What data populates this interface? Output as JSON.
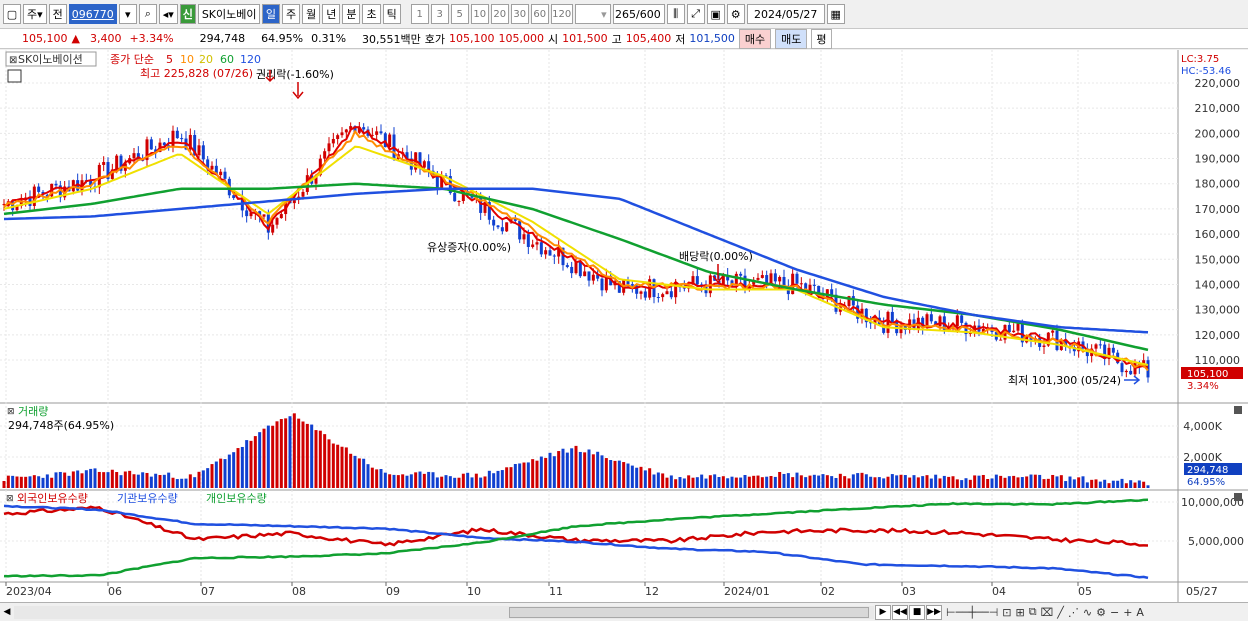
{
  "toolbar": {
    "period_tab": "주",
    "prev_label": "전",
    "stock_code": "096770",
    "new_badge": "신",
    "stock_name": "SK이노베이",
    "intervals": [
      "일",
      "주",
      "월",
      "년",
      "분",
      "초",
      "틱"
    ],
    "active_interval": "일",
    "minute_options": [
      "1",
      "3",
      "5",
      "10",
      "20",
      "30",
      "60",
      "120"
    ],
    "count_display": "265",
    "count_total": "/600",
    "date_value": "2024/05/27"
  },
  "infobar": {
    "price": "105,100",
    "change": "3,400",
    "change_pct": "+3.34%",
    "volume": "294,748",
    "volume_ratio": "64.95%",
    "turnover_rate": "0.31%",
    "trade_value": "30,551백만",
    "bid_ask_label": "호가",
    "bid": "105,100",
    "ask": "105,000",
    "open_label": "시",
    "open": "101,500",
    "high_label": "고",
    "high": "105,400",
    "low_label": "저",
    "low": "101,500",
    "buy_label": "매수",
    "sell_label": "매도",
    "avg_label": "평"
  },
  "price_panel": {
    "name_tag": "SK이노베이션",
    "ma_label": "종가 단순",
    "ma_periods": [
      "5",
      "10",
      "20",
      "60",
      "120"
    ],
    "high_note": "최고 225,828 (07/26)",
    "low_note": "최저 101,300 (05/24)",
    "event_rights": "권리락(-1.60%)",
    "event_paid_in": "유상증자(0.00%)",
    "event_dividend": "배당락(0.00%)",
    "lc": "LC:3.75",
    "hc": "HC:-53.46",
    "y_ticks": [
      "220,000",
      "210,000",
      "200,000",
      "190,000",
      "180,000",
      "170,000",
      "160,000",
      "150,000",
      "140,000",
      "130,000",
      "120,000",
      "110,000"
    ],
    "last_price": "105,100",
    "last_pct": "3.34%"
  },
  "volume_panel": {
    "title": "거래량",
    "subtitle": "294,748주(64.95%)",
    "y_ticks": [
      "4,000K",
      "2,000K"
    ],
    "last_value": "294,748",
    "last_pct": "64.95%"
  },
  "holding_panel": {
    "legend_foreign": "외국인보유수량",
    "legend_inst": "기관보유수량",
    "legend_indiv": "개인보유수량",
    "y_ticks": [
      "10,000,000",
      "5,000,000"
    ]
  },
  "x_axis": {
    "labels": [
      "2023/04",
      "06",
      "07",
      "08",
      "09",
      "10",
      "11",
      "12",
      "2024/01",
      "02",
      "03",
      "04",
      "05"
    ],
    "last_date": "05/27"
  },
  "colors": {
    "ma5": "#e00000",
    "ma10": "#ff8c00",
    "ma20": "#f0e000",
    "ma60": "#10a030",
    "ma120": "#2050e0",
    "up": "#d00000",
    "down": "#1040d0",
    "foreign": "#d00000",
    "inst": "#2050e0",
    "indiv": "#10a030"
  },
  "chart_data": [
    {
      "type": "line",
      "title": "SK이노베이션",
      "x": [
        "2023/04",
        "05",
        "06",
        "07",
        "08",
        "09",
        "10",
        "11",
        "12",
        "2024/01",
        "02",
        "03",
        "04",
        "05/27"
      ],
      "series": [
        {
          "name": "종가",
          "values": [
            172000,
            182000,
            200000,
            162000,
            205000,
            180000,
            158000,
            138000,
            140000,
            140000,
            125000,
            124000,
            118000,
            105100
          ]
        },
        {
          "name": "5",
          "values": [
            172000,
            181000,
            198000,
            163000,
            203000,
            181000,
            160000,
            139000,
            140000,
            139000,
            125000,
            123000,
            118000,
            106000
          ]
        },
        {
          "name": "10",
          "values": [
            171000,
            180000,
            196000,
            165000,
            200000,
            182000,
            162000,
            140000,
            139000,
            139000,
            124000,
            122000,
            117000,
            107000
          ]
        },
        {
          "name": "20",
          "values": [
            170000,
            178000,
            192000,
            168000,
            195000,
            183000,
            165000,
            142000,
            138000,
            138000,
            123000,
            121000,
            116000,
            108000
          ]
        },
        {
          "name": "60",
          "values": [
            168000,
            172000,
            178000,
            178000,
            180000,
            178000,
            170000,
            158000,
            145000,
            138000,
            132000,
            128000,
            122000,
            114000
          ]
        },
        {
          "name": "120",
          "values": [
            166000,
            167000,
            170000,
            173000,
            176000,
            178000,
            178000,
            174000,
            160000,
            146000,
            135000,
            128000,
            123000,
            121000
          ]
        }
      ],
      "ylim": [
        100000,
        226000
      ]
    },
    {
      "type": "bar",
      "title": "거래량",
      "x": [
        "2023/04",
        "06",
        "07",
        "08",
        "09",
        "10",
        "11",
        "12",
        "2024/01",
        "02",
        "03",
        "04",
        "05/27"
      ],
      "values": [
        600000,
        1100000,
        700000,
        4800000,
        900000,
        800000,
        2600000,
        700000,
        900000,
        800000,
        700000,
        700000,
        294748
      ],
      "ylim": [
        0,
        5000000
      ]
    },
    {
      "type": "line",
      "title": "보유수량",
      "x": [
        "2023/04",
        "06",
        "07",
        "08",
        "09",
        "10",
        "11",
        "12",
        "2024/01",
        "02",
        "03",
        "04",
        "05/27"
      ],
      "series": [
        {
          "name": "외국인보유수량",
          "values": [
            8500000,
            9300000,
            5200000,
            6000000,
            4500000,
            6500000,
            5100000,
            5000000,
            6200000,
            6400000,
            6100000,
            5200000,
            4600000
          ]
        },
        {
          "name": "기관보유수량",
          "values": [
            9500000,
            9000000,
            7200000,
            6900000,
            6600000,
            5400000,
            4900000,
            4000000,
            3600000,
            2000000,
            1800000,
            1500000,
            300000
          ]
        },
        {
          "name": "개인보유수량",
          "values": [
            500000,
            600000,
            2800000,
            3000000,
            3400000,
            4800000,
            6900000,
            7800000,
            8500000,
            9200000,
            9800000,
            9700000,
            10300000
          ]
        }
      ],
      "ylim": [
        0,
        10500000
      ]
    }
  ]
}
